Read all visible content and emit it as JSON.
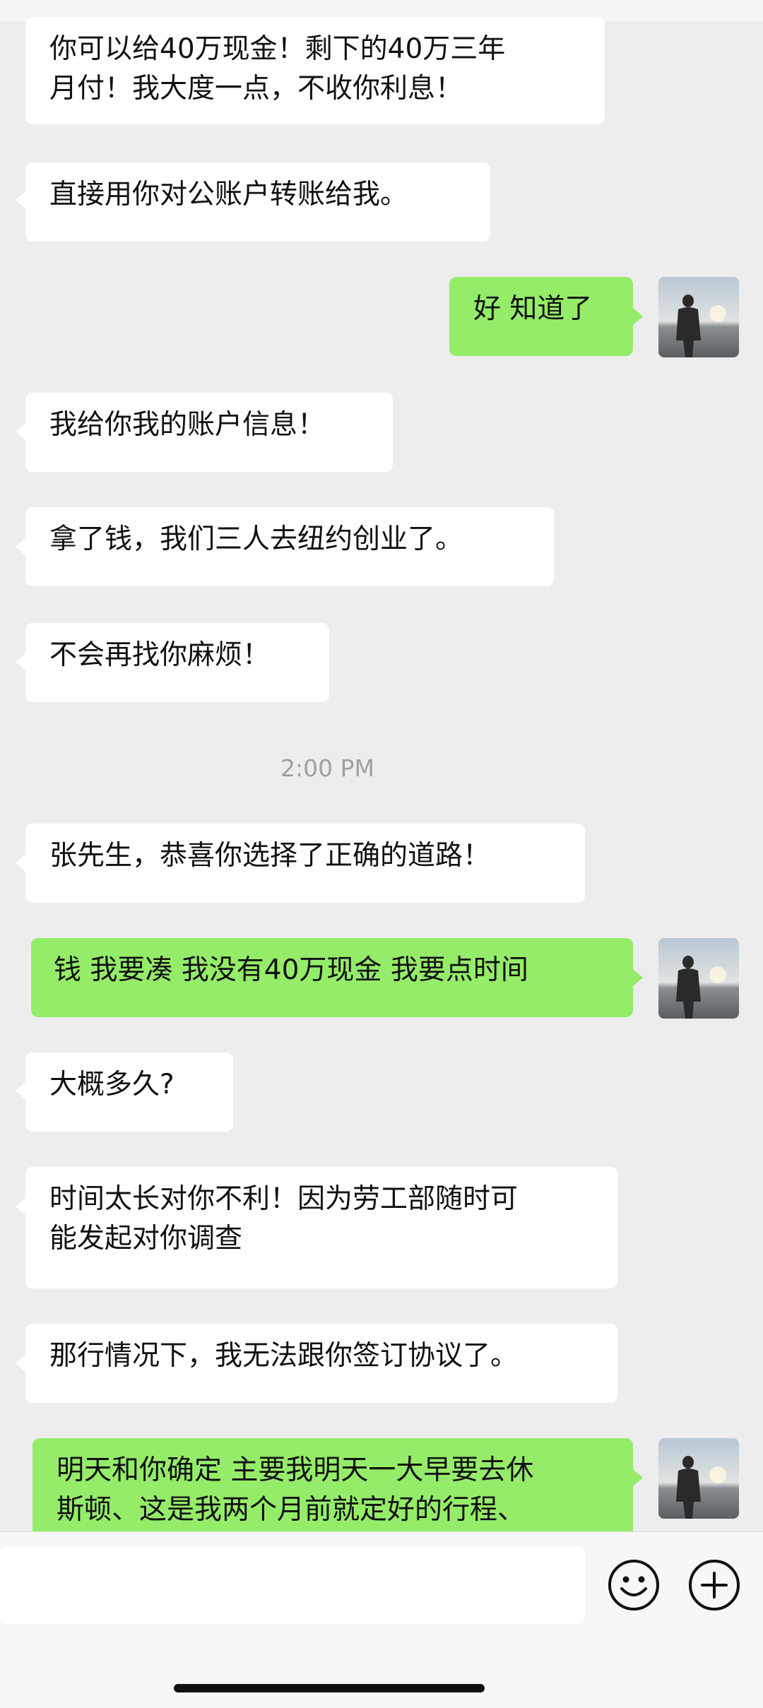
{
  "messages": [
    {
      "side": "in",
      "text": "你可以给40万现金！剩下的40万三年\n月付！我大度一点，不收你利息！"
    },
    {
      "side": "in",
      "text": "直接用你对公账户转账给我。"
    },
    {
      "side": "out",
      "text": "好 知道了"
    },
    {
      "side": "in",
      "text": "我给你我的账户信息！"
    },
    {
      "side": "in",
      "text": "拿了钱，我们三人去纽约创业了。"
    },
    {
      "side": "in",
      "text": "不会再找你麻烦！"
    },
    {
      "side": "in",
      "text": "张先生，恭喜你选择了正确的道路！"
    },
    {
      "side": "out",
      "text": "钱 我要凑 我没有40万现金 我要点时间"
    },
    {
      "side": "in",
      "text": "大概多久?"
    },
    {
      "side": "in",
      "text": "时间太长对你不利！因为劳工部随时可\n能发起对你调查"
    },
    {
      "side": "in",
      "text": "那行情况下，我无法跟你签订协议了。"
    },
    {
      "side": "out",
      "text": "明天和你确定 主要我明天一大早要去休\n斯顿、这是我两个月前就定好的行程、"
    }
  ],
  "timestamp": "2:00 PM",
  "colors": {
    "background": "#ededed",
    "incoming": "#ffffff",
    "outgoing": "#95ec69"
  },
  "icons": {
    "emoji": "emoji-face-icon",
    "plus": "plus-circle-icon"
  }
}
